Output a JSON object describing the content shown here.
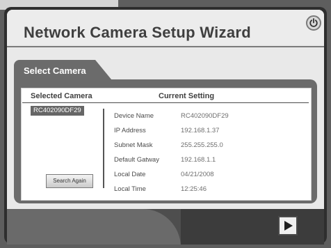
{
  "header": {
    "title": "Network Camera Setup Wizard",
    "power_icon": "power-icon"
  },
  "tab": {
    "label": "Select Camera"
  },
  "table": {
    "col_selected": "Selected Camera",
    "col_current": "Current Setting"
  },
  "cameras": [
    "RC402090DF29"
  ],
  "search_button": "Search Again",
  "settings": [
    {
      "label": "Device Name",
      "value": "RC402090DF29"
    },
    {
      "label": "IP Address",
      "value": "192.168.1.37"
    },
    {
      "label": "Subnet Mask",
      "value": "255.255.255.0"
    },
    {
      "label": "Default Gatway",
      "value": "192.168.1.1"
    },
    {
      "label": "Local Date",
      "value": "04/21/2008"
    },
    {
      "label": "Local Time",
      "value": "12:25:46"
    }
  ],
  "next_icon": "play-triangle-icon"
}
